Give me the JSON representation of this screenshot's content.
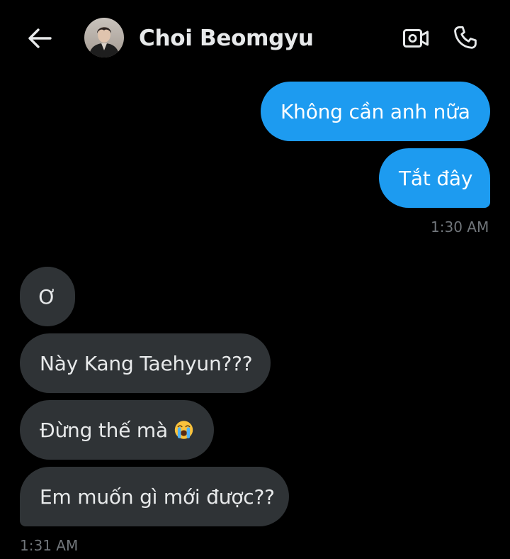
{
  "header": {
    "contact_name": "Choi Beomgyu",
    "back_icon": "arrow-left-icon",
    "video_icon": "video-camera-icon",
    "call_icon": "phone-icon"
  },
  "colors": {
    "background": "#000000",
    "sent_bubble": "#1d9bf0",
    "received_bubble": "#2f3336",
    "timestamp": "#71767b"
  },
  "messages": {
    "sent": [
      {
        "text": "Không cần anh nữa"
      },
      {
        "text": "Tắt đây"
      }
    ],
    "sent_time": "1:30 AM",
    "received": [
      {
        "text": "Ơ"
      },
      {
        "text": "Này Kang Taehyun???"
      },
      {
        "text": "Đừng thế mà",
        "emoji": "loudly-crying-face-icon"
      },
      {
        "text": "Em muốn gì mới được??"
      }
    ],
    "received_time": "1:31 AM"
  }
}
